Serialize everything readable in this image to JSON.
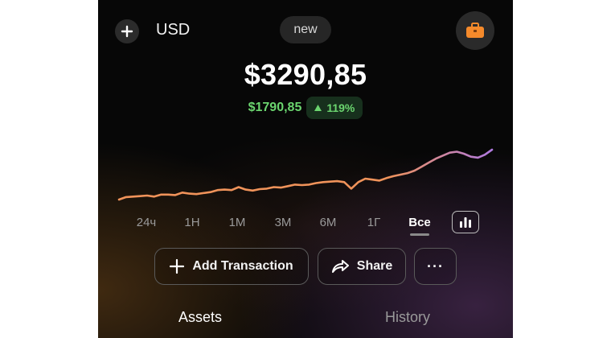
{
  "header": {
    "currency": "USD",
    "badge": "new"
  },
  "portfolio": {
    "balance": "$3290,85",
    "change_amount": "$1790,85",
    "change_percent": "119%",
    "change_direction": "up",
    "positive_color": "#6bd56f"
  },
  "chart_data": {
    "type": "line",
    "title": "",
    "xlabel": "",
    "ylabel": "",
    "gradient_colors": [
      "#f0935a",
      "#b07ae0"
    ],
    "y": [
      0.0,
      0.05,
      0.06,
      0.07,
      0.08,
      0.06,
      0.1,
      0.1,
      0.09,
      0.14,
      0.12,
      0.11,
      0.13,
      0.15,
      0.19,
      0.2,
      0.19,
      0.25,
      0.2,
      0.18,
      0.21,
      0.22,
      0.25,
      0.24,
      0.27,
      0.3,
      0.29,
      0.3,
      0.33,
      0.35,
      0.36,
      0.37,
      0.35,
      0.22,
      0.35,
      0.42,
      0.4,
      0.38,
      0.43,
      0.47,
      0.5,
      0.53,
      0.58,
      0.66,
      0.74,
      0.82,
      0.88,
      0.94,
      0.96,
      0.92,
      0.86,
      0.84,
      0.9,
      1.0
    ]
  },
  "ranges": {
    "items": [
      "24ч",
      "1Н",
      "1М",
      "3М",
      "6М",
      "1Г",
      "Все"
    ],
    "active": "Все"
  },
  "actions": {
    "add_transaction": "Add Transaction",
    "share": "Share",
    "more": "···"
  },
  "tabs": {
    "assets": "Assets",
    "history": "History"
  }
}
